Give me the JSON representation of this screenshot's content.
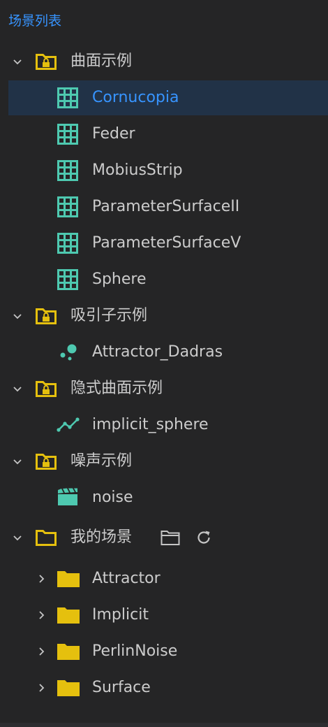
{
  "panel": {
    "title": "场景列表"
  },
  "groups": [
    {
      "label": "曲面示例",
      "items": [
        "Cornucopia",
        "Feder",
        "MobiusStrip",
        "ParameterSurfaceII",
        "ParameterSurfaceV",
        "Sphere"
      ]
    },
    {
      "label": "吸引子示例",
      "items": [
        "Attractor_Dadras"
      ]
    },
    {
      "label": "隐式曲面示例",
      "items": [
        "implicit_sphere"
      ]
    },
    {
      "label": "噪声示例",
      "items": [
        "noise"
      ]
    },
    {
      "label": "我的场景",
      "folders": [
        "Attractor",
        "Implicit",
        "PerlinNoise",
        "Surface"
      ]
    }
  ],
  "selected_item": "Cornucopia",
  "icons": {
    "group": "locked-folder-icon",
    "surface": "grid-icon",
    "attractor": "dots-icon",
    "implicit": "line-chart-icon",
    "noise": "clapperboard-icon",
    "folder": "folder-icon",
    "open_folder": "open-folder-icon",
    "refresh": "refresh-icon"
  },
  "colors": {
    "accent": "#3794ff",
    "folder": "#e5c00e",
    "teal": "#4ec9b0",
    "text": "#cccccc",
    "selection": "#213247",
    "background": "#252526"
  }
}
